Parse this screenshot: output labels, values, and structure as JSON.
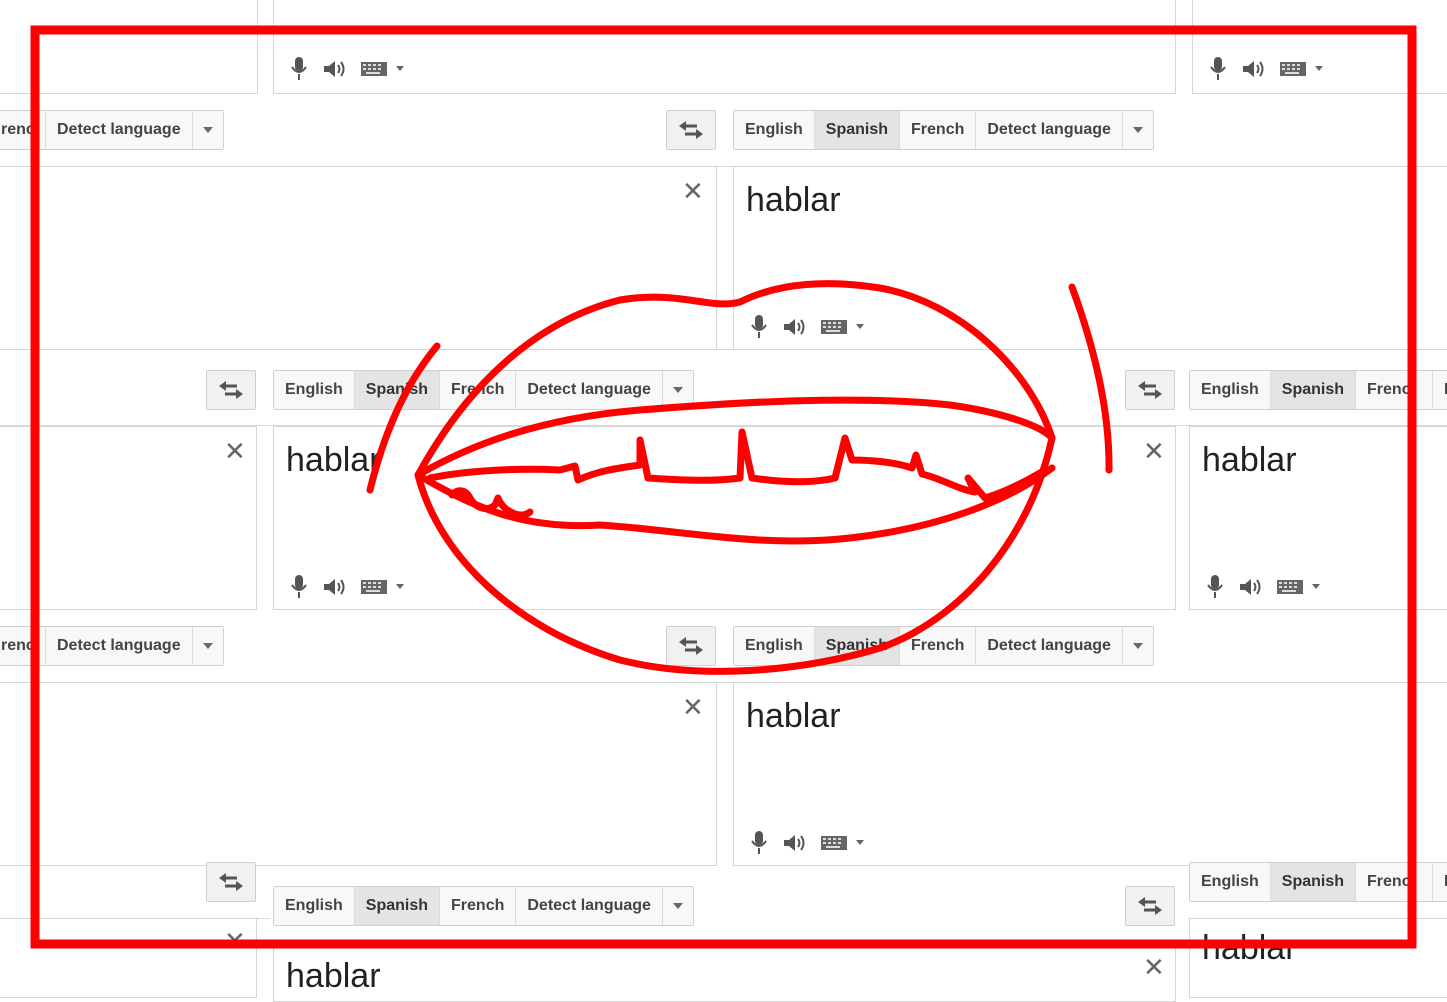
{
  "languages": {
    "english": "English",
    "spanish": "Spanish",
    "french": "French",
    "french_clipped": "Frencl",
    "french_clipped_left": "renc",
    "detect": "Detect language",
    "detect_clipped": "D"
  },
  "translation_word": "hablar",
  "selected_language": "Spanish",
  "icons": [
    "microphone-icon",
    "speaker-icon",
    "keyboard-icon",
    "dropdown-arrow-icon",
    "swap-languages-icon",
    "close-icon"
  ],
  "annotation": {
    "drawing": "mouth-lips",
    "frame_color": "#ff0000",
    "stroke_color": "#ff0000"
  }
}
